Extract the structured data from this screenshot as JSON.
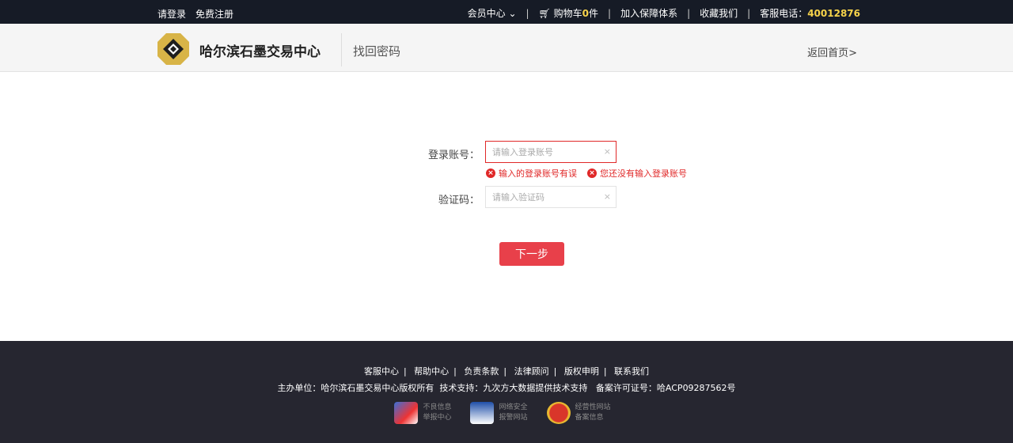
{
  "topbar": {
    "login": "请登录",
    "register": "免费注册",
    "member": "会员中心",
    "cart_prefix": "购物车",
    "cart_count": "0",
    "cart_suffix": "件",
    "join": "加入保障体系",
    "favorite": "收藏我们",
    "phone_label": "客服电话：",
    "phone": "40012876"
  },
  "header": {
    "brand": "哈尔滨石墨交易中心",
    "subtitle": "找回密码",
    "back": "返回首页>"
  },
  "form": {
    "account_label": "登录账号：",
    "account_placeholder": "请输入登录账号",
    "error1": "输入的登录账号有误",
    "error2": "您还没有输入登录账号",
    "code_label": "验证码：",
    "code_placeholder": "请输入验证码",
    "next": "下一步",
    "clear": "×"
  },
  "footer": {
    "links": [
      "客服中心",
      "帮助中心",
      "负责条款",
      "法律顾问",
      "版权申明",
      "联系我们"
    ],
    "info": "主办单位：哈尔滨石墨交易中心版权所有  技术支持：九次方大数据提供技术支持   备案许可证号：哈ACP09287562号",
    "badges": [
      {
        "l1": "不良信息",
        "l2": "举报中心"
      },
      {
        "l1": "网络安全",
        "l2": "报警网站"
      },
      {
        "l1": "经营性网站",
        "l2": "备案信息"
      }
    ]
  },
  "colors": {
    "accent": "#e8404a",
    "topbar": "#161b26",
    "footer": "#262630",
    "highlight": "#f7d34a"
  }
}
